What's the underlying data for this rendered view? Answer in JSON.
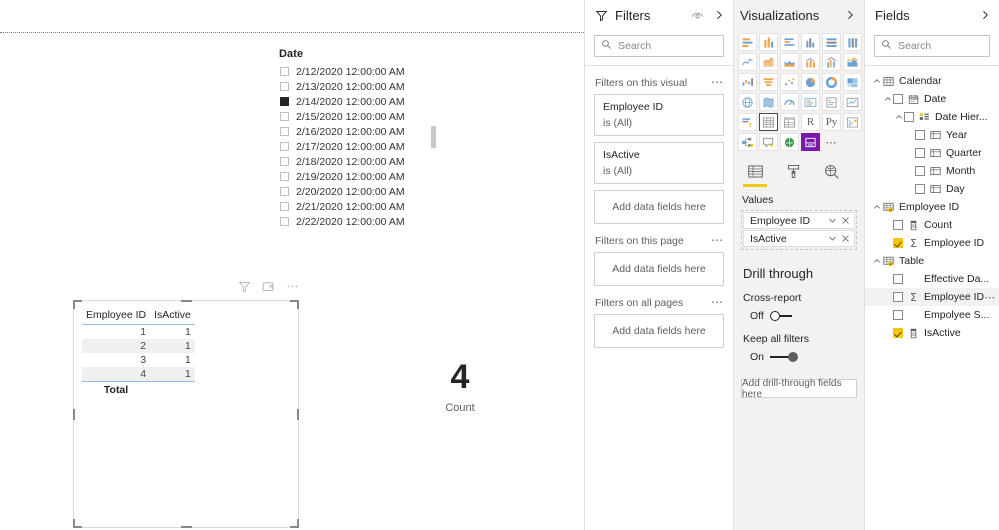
{
  "canvas": {
    "slicer": {
      "title": "Date",
      "items": [
        {
          "label": "2/12/2020 12:00:00 AM",
          "checked": false
        },
        {
          "label": "2/13/2020 12:00:00 AM",
          "checked": false
        },
        {
          "label": "2/14/2020 12:00:00 AM",
          "checked": true
        },
        {
          "label": "2/15/2020 12:00:00 AM",
          "checked": false
        },
        {
          "label": "2/16/2020 12:00:00 AM",
          "checked": false
        },
        {
          "label": "2/17/2020 12:00:00 AM",
          "checked": false
        },
        {
          "label": "2/18/2020 12:00:00 AM",
          "checked": false
        },
        {
          "label": "2/19/2020 12:00:00 AM",
          "checked": false
        },
        {
          "label": "2/20/2020 12:00:00 AM",
          "checked": false
        },
        {
          "label": "2/21/2020 12:00:00 AM",
          "checked": false
        },
        {
          "label": "2/22/2020 12:00:00 AM",
          "checked": false
        }
      ]
    },
    "table_visual": {
      "columns": [
        "Employee ID",
        "IsActive"
      ],
      "rows": [
        [
          "1",
          "1"
        ],
        [
          "2",
          "1"
        ],
        [
          "3",
          "1"
        ],
        [
          "4",
          "1"
        ]
      ],
      "total_label": "Total",
      "total_values": [
        "",
        ""
      ],
      "header_icons": [
        "filter-icon",
        "focus-mode-icon",
        "more-options-icon"
      ]
    },
    "card_visual": {
      "value": "4",
      "label": "Count"
    }
  },
  "filters": {
    "title": "Filters",
    "header_icons": [
      "hide-pane-icon",
      "collapse-icon"
    ],
    "search_placeholder": "Search",
    "groups": [
      {
        "title": "Filters on this visual",
        "cards": [
          {
            "name": "Employee ID",
            "state": "is (All)"
          },
          {
            "name": "IsActive",
            "state": "is (All)"
          }
        ],
        "dropzone": "Add data fields here"
      },
      {
        "title": "Filters on this page",
        "cards": [],
        "dropzone": "Add data fields here"
      },
      {
        "title": "Filters on all pages",
        "cards": [],
        "dropzone": "Add data fields here"
      }
    ]
  },
  "visualizations": {
    "title": "Visualizations",
    "collapse_icon": "collapse-icon",
    "icon_rows": [
      [
        "stacked-bar-chart",
        "stacked-column-chart",
        "clustered-bar-chart",
        "clustered-column-chart",
        "100-percent-stacked-bar-chart",
        "100-percent-stacked-column-chart"
      ],
      [
        "line-chart",
        "area-chart",
        "stacked-area-chart",
        "line-and-stacked-column-chart",
        "line-and-clustered-column-chart",
        "ribbon-chart"
      ],
      [
        "waterfall-chart",
        "funnel-chart",
        "scatter-chart",
        "pie-chart",
        "donut-chart",
        "treemap"
      ],
      [
        "map",
        "filled-map",
        "gauge",
        "multi-row-card",
        "card",
        "kpi"
      ],
      [
        "slicer",
        "table",
        "matrix",
        "r-script-visual",
        "python-visual",
        "key-influencers"
      ],
      [
        "decomposition-tree",
        "qna-visual",
        "arcgis-map",
        "paginated-report",
        "more-visuals"
      ]
    ],
    "selected_icon": "table",
    "active_icon": "paginated-report",
    "tabs": [
      {
        "name": "fields-tab",
        "icon": "fields-icon",
        "active": true
      },
      {
        "name": "format-tab",
        "icon": "paint-roller-icon",
        "active": false
      },
      {
        "name": "analytics-tab",
        "icon": "analytics-magnifier-icon",
        "active": false
      }
    ],
    "well_label": "Values",
    "wells": [
      {
        "name": "Employee ID"
      },
      {
        "name": "IsActive"
      }
    ],
    "drill_through": {
      "title": "Drill through",
      "cross_report_label": "Cross-report",
      "cross_report_state": "Off",
      "keep_filters_label": "Keep all filters",
      "keep_filters_state": "On",
      "dropzone": "Add drill-through fields here"
    }
  },
  "fields": {
    "title": "Fields",
    "collapse_icon": "collapse-icon",
    "search_placeholder": "Search",
    "tree": [
      {
        "label": "Calendar",
        "indent": 0,
        "chevron": "up",
        "checkbox": null,
        "icon": "table-icon",
        "measure": false,
        "hover": false,
        "dots": false
      },
      {
        "label": "Date",
        "indent": 1,
        "chevron": "up",
        "checkbox": false,
        "icon": "calendar-icon",
        "measure": false,
        "hover": false,
        "dots": false
      },
      {
        "label": "Date Hier...",
        "indent": 2,
        "chevron": "up",
        "checkbox": false,
        "icon": "hierarchy-icon",
        "measure": false,
        "hover": false,
        "dots": false
      },
      {
        "label": "Year",
        "indent": 3,
        "chevron": "none",
        "checkbox": false,
        "icon": "field-icon",
        "measure": false,
        "hover": false,
        "dots": false
      },
      {
        "label": "Quarter",
        "indent": 3,
        "chevron": "none",
        "checkbox": false,
        "icon": "field-icon",
        "measure": false,
        "hover": false,
        "dots": false
      },
      {
        "label": "Month",
        "indent": 3,
        "chevron": "none",
        "checkbox": false,
        "icon": "field-icon",
        "measure": false,
        "hover": false,
        "dots": false
      },
      {
        "label": "Day",
        "indent": 3,
        "chevron": "none",
        "checkbox": false,
        "icon": "field-icon",
        "measure": false,
        "hover": false,
        "dots": false
      },
      {
        "label": "Employee ID",
        "indent": 0,
        "chevron": "up",
        "checkbox": null,
        "icon": "table-active-icon",
        "measure": false,
        "hover": false,
        "dots": false
      },
      {
        "label": "Count",
        "indent": 1,
        "chevron": "none",
        "checkbox": false,
        "icon": "column-icon",
        "measure": false,
        "hover": false,
        "dots": false
      },
      {
        "label": "Employee ID",
        "indent": 1,
        "chevron": "none",
        "checkbox": true,
        "icon": "none",
        "measure": true,
        "hover": false,
        "dots": false
      },
      {
        "label": "Table",
        "indent": 0,
        "chevron": "up",
        "checkbox": null,
        "icon": "table-active-icon",
        "measure": false,
        "hover": false,
        "dots": false
      },
      {
        "label": "Effective Da...",
        "indent": 1,
        "chevron": "none",
        "checkbox": false,
        "icon": "none",
        "measure": false,
        "hover": false,
        "dots": false
      },
      {
        "label": "Employee ID",
        "indent": 1,
        "chevron": "none",
        "checkbox": false,
        "icon": "none",
        "measure": true,
        "hover": true,
        "dots": true
      },
      {
        "label": "Empolyee S...",
        "indent": 1,
        "chevron": "none",
        "checkbox": false,
        "icon": "none",
        "measure": false,
        "hover": false,
        "dots": false
      },
      {
        "label": "IsActive",
        "indent": 1,
        "chevron": "none",
        "checkbox": true,
        "icon": "column-icon",
        "measure": false,
        "hover": false,
        "dots": false
      }
    ]
  },
  "colors": {
    "accent_yellow": "#F2C811",
    "pane_bg": "#F3F2F1",
    "border": "#E1DFDD",
    "text": "#252423",
    "muted_text": "#605E5C",
    "purple_active": "#7719AA",
    "table_rule": "#94BDE0"
  }
}
